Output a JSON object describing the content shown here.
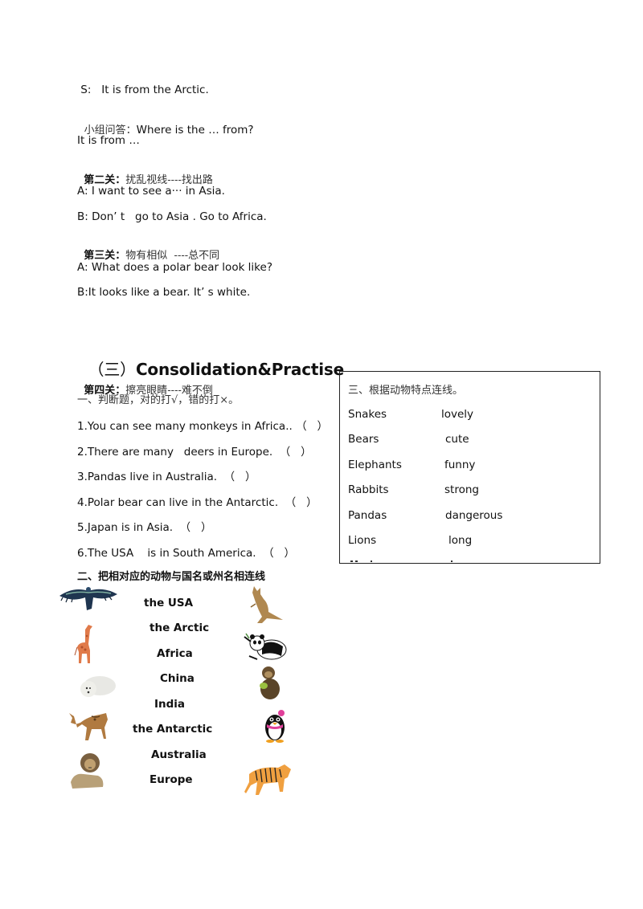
{
  "dialogue": {
    "line1": " S:   It is from the Arctic.",
    "line2_cn": "小组问答：",
    "line2_en": "Where is the … from?",
    "line3": "It is from …",
    "level2_bold": "第二关：",
    "level2_rest": "扰乱视线----找出路",
    "line5": "A: I want to see a··· in Asia.",
    "line6": "B: Don’ t   go to Asia . Go to Africa.",
    "level3_bold": "第三关：",
    "level3_rest": "物有相似  ----总不同",
    "line8": "A: What does a polar bear look like?",
    "line9": "B:It looks like a bear. It’ s white."
  },
  "section": {
    "paren": "（三）",
    "title": "Consolidation&Practise"
  },
  "level4": {
    "bold": "第四关：",
    "rest": "擦亮眼睛----难不倒"
  },
  "true_false": {
    "instruction": "一、判断题，对的打√，错的打×。",
    "items": [
      "1.You can see many monkeys in Africa.. （   ）",
      "2.There are many   deers in Europe.  （   ）",
      "3.Pandas live in Australia.  （   ）",
      "4.Polar bear can live in the Antarctic.  （   ）",
      "5.Japan is in Asia.  （   ）",
      "6.The USA    is in South America.  （   ）"
    ]
  },
  "matching_places": {
    "instruction": "二、把相对应的动物与国名或州名相连线",
    "places": [
      "the USA",
      "the Arctic",
      "Africa",
      "China",
      "India",
      "the Antarctic",
      "Australia",
      "Europe"
    ],
    "left_animals": [
      "eagle-icon",
      "giraffe-icon",
      "polar-bear-icon",
      "deer-icon",
      "lion-icon"
    ],
    "right_animals": [
      "kangaroo-icon",
      "panda-icon",
      "monkey-icon",
      "penguin-icon",
      "tiger-icon"
    ]
  },
  "matching_traits": {
    "title": "三、根据动物特点连线。",
    "rows": [
      {
        "animal": "Snakes",
        "trait": "lovely"
      },
      {
        "animal": "Bears",
        "trait": "cute"
      },
      {
        "animal": "Elephants",
        "trait": "funny"
      },
      {
        "animal": "Rabbits",
        "trait": "strong"
      },
      {
        "animal": "Pandas",
        "trait": "dangerous"
      },
      {
        "animal": "Lions",
        "trait": "long"
      }
    ]
  }
}
